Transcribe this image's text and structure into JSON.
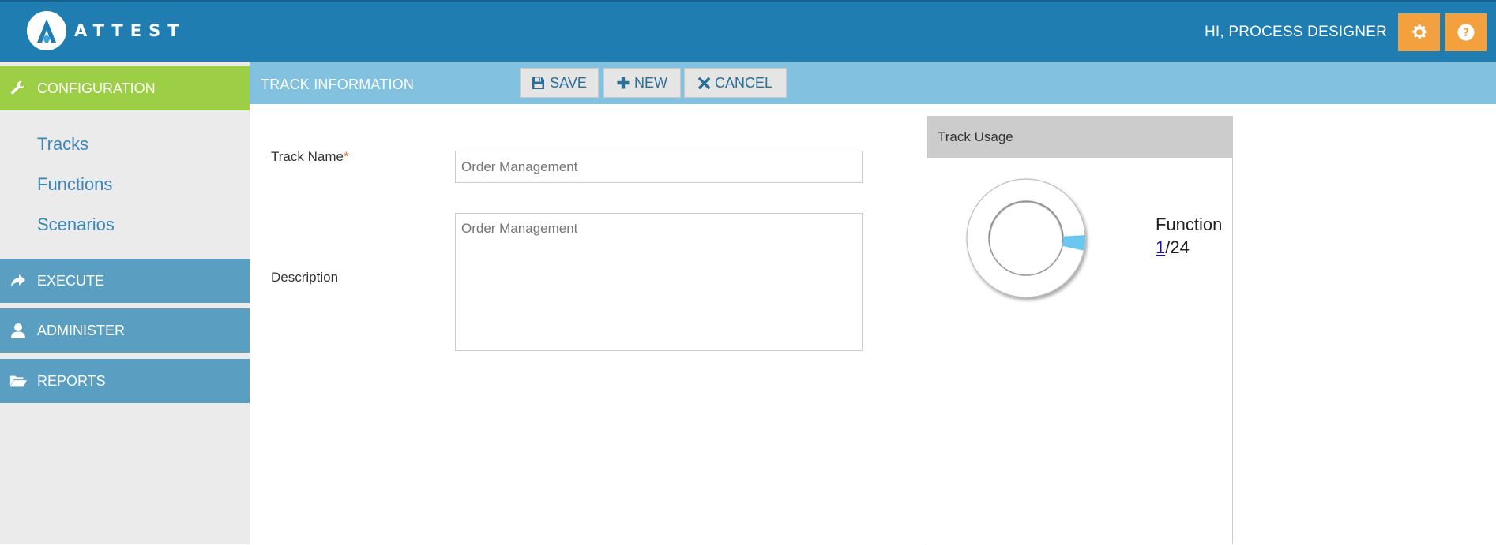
{
  "header": {
    "brand": "ATTEST",
    "greeting": "HI, PROCESS DESIGNER",
    "settings_icon": "gear-icon",
    "help_icon": "question-circle-icon",
    "accent_color": "#f3a13e",
    "bar_color": "#1f7db1"
  },
  "sidebar": {
    "configuration": {
      "label": "CONFIGURATION",
      "icon": "wrench-icon",
      "color": "#9cce46"
    },
    "sub_items": [
      {
        "label": "Tracks"
      },
      {
        "label": "Functions"
      },
      {
        "label": "Scenarios"
      }
    ],
    "execute": {
      "label": "EXECUTE",
      "icon": "share-arrow-icon"
    },
    "administer": {
      "label": "ADMINISTER",
      "icon": "user-icon"
    },
    "reports": {
      "label": "REPORTS",
      "icon": "folder-open-icon"
    }
  },
  "toolbar": {
    "title": "TRACK INFORMATION",
    "save_label": "SAVE",
    "new_label": "NEW",
    "cancel_label": "CANCEL"
  },
  "form": {
    "track_name_label": "Track Name",
    "required_marker": "*",
    "track_name_placeholder": "Order Management",
    "description_label": "Description",
    "description_placeholder": "Order Management"
  },
  "usage": {
    "title": "Track Usage",
    "metric_label": "Functions",
    "used": "1",
    "total_text": "/24",
    "used_fraction": 0.0417,
    "slice_color": "#6cc7f0"
  }
}
